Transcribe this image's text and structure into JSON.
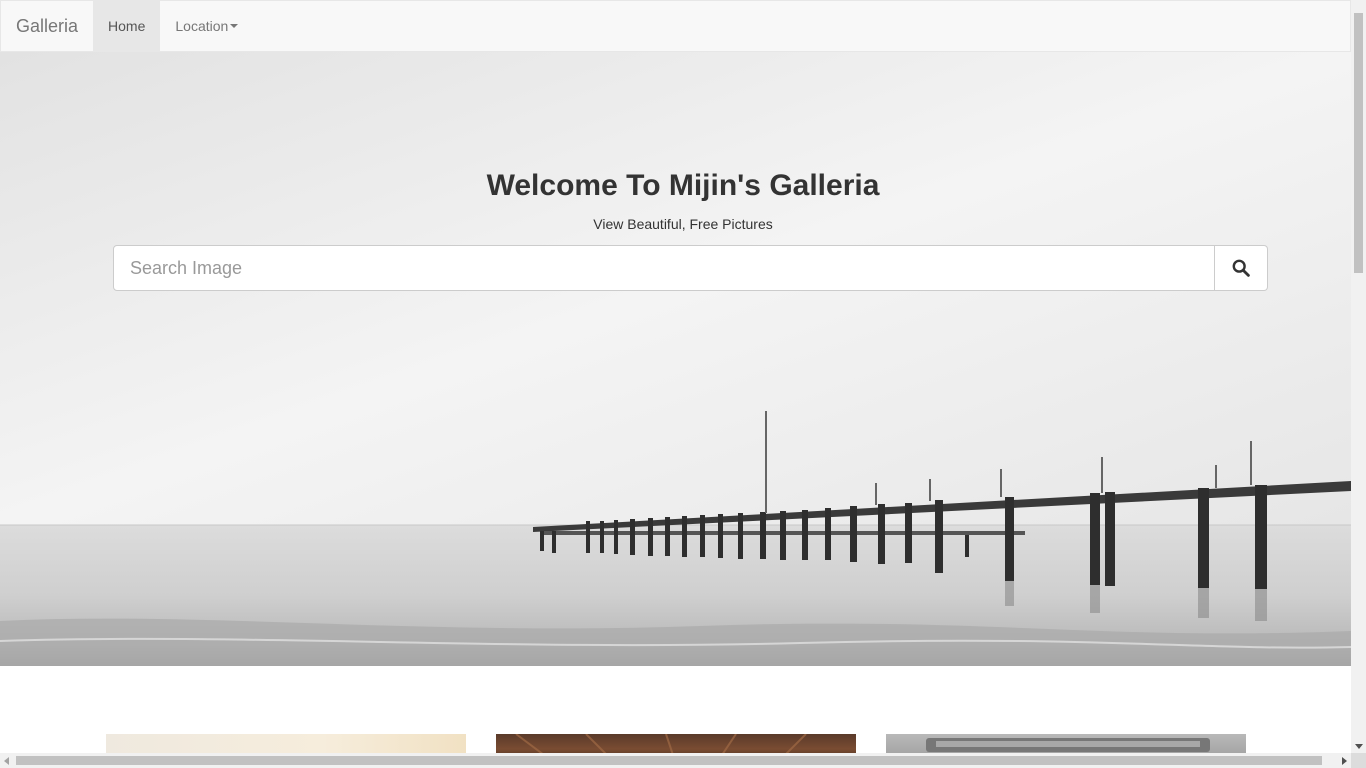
{
  "navbar": {
    "brand": "Galleria",
    "items": [
      {
        "label": "Home",
        "active": true
      },
      {
        "label": "Location",
        "dropdown": true
      }
    ]
  },
  "hero": {
    "title": "Welcome To Mijin's Galleria",
    "subtitle": "View Beautiful, Free Pictures",
    "search": {
      "placeholder": "Search Image",
      "value": "",
      "button_icon": "search-icon"
    },
    "background_image": "black-and-white-pier-over-sea"
  },
  "gallery": {
    "thumbnails": [
      "warm-beige-photo",
      "wooden-interior-photo",
      "grey-bus-photo"
    ]
  },
  "colors": {
    "navbar_bg": "#f8f8f8",
    "active_tab_bg": "#e7e7e7",
    "text_dark": "#333333",
    "text_muted": "#777777"
  }
}
